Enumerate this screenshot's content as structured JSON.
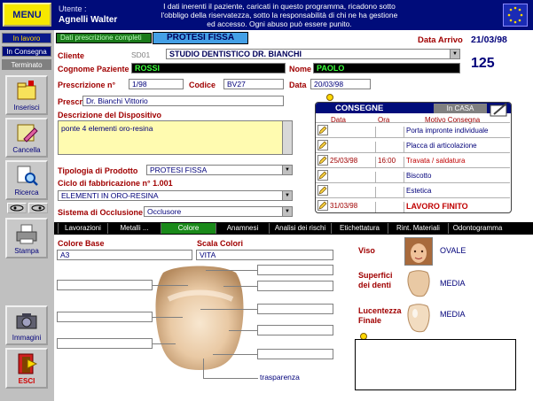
{
  "header": {
    "menu_label": "MENU",
    "user_label": "Utente :",
    "user_name": "Agnelli Walter",
    "notice": "I dati inerenti il paziente, caricati in questo programma, ricadono sotto l'obbligo della riservatezza, sotto la responsabilità di chi ne ha gestione ed accesso. Ogni abuso può essere punito."
  },
  "sidebar": {
    "status_in_lavoro": "In lavoro",
    "status_in_consegna": "In Consegna",
    "status_terminato": "Terminato",
    "insert_label": "Inserisci",
    "delete_label": "Cancella",
    "search_label": "Ricerca",
    "print_label": "Stampa",
    "images_label": "Immagini",
    "exit_label": "ESCI"
  },
  "form": {
    "data_prescription_tab": "Dati prescrizione completi",
    "prescription_type": "PROTESI FISSA",
    "arrival_date_label": "Data Arrivo",
    "arrival_date": "21/03/98",
    "client_label": "Cliente",
    "client_code": "SD01",
    "client_name": "STUDIO DENTISTICO  DR. BIANCHI",
    "record_number": "125",
    "surname_label": "Cognome Paziente",
    "surname": "ROSSI",
    "name_label": "Nome",
    "name": "PAOLO",
    "prescription_no_label": "Prescrizione n°",
    "prescription_no": "1/98",
    "code_label": "Codice",
    "code": "BV27",
    "date_label": "Data",
    "date": "20/03/98",
    "prescriber_label": "Prescrivente",
    "prescriber": "Dr. Bianchi Vittorio",
    "device_desc_label": "Descrizione del Dispositivo",
    "device_desc": "ponte 4 elementi oro-resina",
    "product_type_label": "Tipologia di Prodotto",
    "product_type": "PROTESI FISSA",
    "cycle_label": "Ciclo di fabbricazione n° 1.001",
    "cycle": "ELEMENTI IN ORO-RESINA",
    "occlusion_label": "Sistema di Occlusione",
    "occlusion": "Occlusore"
  },
  "consegne": {
    "title": "CONSEGNE",
    "in_casa": "In CASA",
    "col_data": "Data",
    "col_ora": "Ora",
    "col_motivo": "Motivo Consegna",
    "rows": [
      {
        "data": "",
        "ora": "",
        "motivo": "Porta impronte individuale"
      },
      {
        "data": "",
        "ora": "",
        "motivo": "Placca di articolazione"
      },
      {
        "data": "25/03/98",
        "ora": "16:00",
        "motivo": "Travata / saldatura"
      },
      {
        "data": "",
        "ora": "",
        "motivo": "Biscotto"
      },
      {
        "data": "",
        "ora": "",
        "motivo": "Estetica"
      },
      {
        "data": "31/03/98",
        "ora": "",
        "motivo": "LAVORO FINITO"
      }
    ]
  },
  "tabs": [
    "Lavorazioni",
    "Metalli ...",
    "Colore",
    "Anamnesi",
    "Analisi dei rischi",
    "Etichettatura",
    "Rint. Materiali",
    "Odontogramma"
  ],
  "colore": {
    "base_label": "Colore Base",
    "base_value": "A3",
    "scala_label": "Scala Colori",
    "scala_value": "VITA",
    "trasparenza_label": "trasparenza",
    "viso_label": "Viso",
    "viso_value": "OVALE",
    "superfici_label": "Superfici dei denti",
    "superfici_value": "MEDIA",
    "lucentezza_label": "Lucentezza Finale",
    "lucentezza_value": "MEDIA"
  }
}
